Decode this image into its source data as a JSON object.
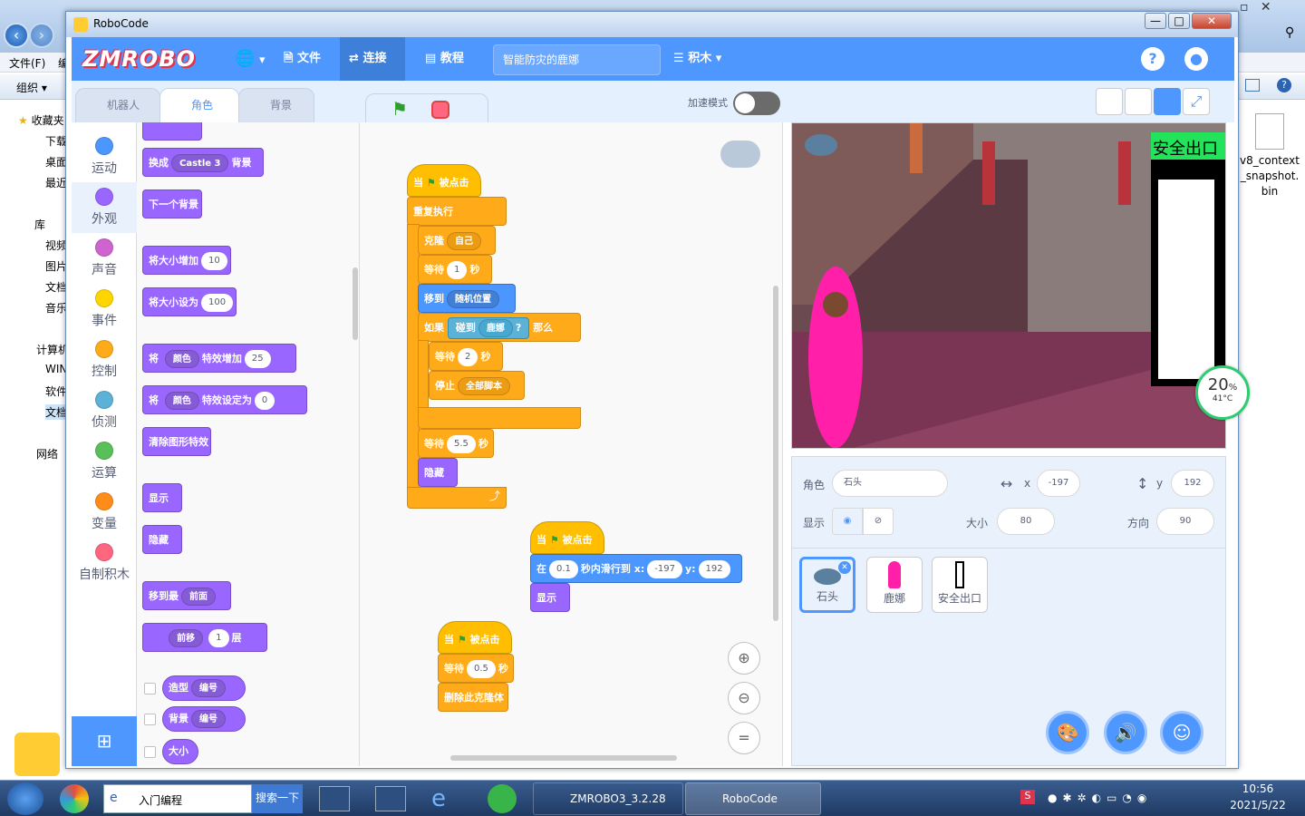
{
  "explorer": {
    "menu": [
      "文件(F)",
      "编"
    ],
    "toolbar_label": "组织 ▾",
    "side_items": [
      "收藏夹",
      "下载",
      "桌面",
      "最近",
      "库",
      "视频",
      "图片",
      "文档",
      "音乐",
      "计算机",
      "WIN",
      "软件",
      "文档",
      "网络"
    ],
    "file_name": "v8_context_snapshot.bin",
    "file_lines": [
      "v8_context",
      "_snapshot.",
      "bin"
    ]
  },
  "window": {
    "title": "RoboCode",
    "controls": [
      "—",
      "□",
      "✕"
    ]
  },
  "menubar": {
    "logo": "ZMROBO",
    "file": "文件",
    "connect": "连接",
    "tutorial": "教程",
    "project_name": "智能防灾的鹿娜",
    "blocks": "积木"
  },
  "tabs": {
    "robot": "机器人",
    "sprite": "角色",
    "backdrop": "背景",
    "turbo": "加速模式"
  },
  "categories": [
    {
      "label": "运动",
      "color": "#4c97ff"
    },
    {
      "label": "外观",
      "color": "#9966ff"
    },
    {
      "label": "声音",
      "color": "#cf63cf"
    },
    {
      "label": "事件",
      "color": "#ffd500"
    },
    {
      "label": "控制",
      "color": "#ffab19"
    },
    {
      "label": "侦测",
      "color": "#5cb1d6"
    },
    {
      "label": "运算",
      "color": "#59c059"
    },
    {
      "label": "变量",
      "color": "#ff8c1a"
    },
    {
      "label": "自制积木",
      "color": "#ff6680"
    }
  ],
  "palette": {
    "switch_backdrop": "换成",
    "backdrop_value": "Castle 3",
    "backdrop_word": "背景",
    "next_backdrop": "下一个背景",
    "change_size": "将大小增加",
    "change_size_val": "10",
    "set_size": "将大小设为",
    "set_size_val": "100",
    "effect_change_pre": "将",
    "effect_name": "颜色",
    "effect_change": "特效增加",
    "effect_change_val": "25",
    "effect_set": "特效设定为",
    "effect_set_val": "0",
    "clear_effects": "清除图形特效",
    "show": "显示",
    "hide": "隐藏",
    "goto_layer": "移到最",
    "layer_value": "前面",
    "go_layers": "前移",
    "layers_val": "1",
    "layers_unit": "层",
    "costume": "造型",
    "costume_sel": "编号",
    "backdrop_rep": "背景",
    "backdrop_sel": "编号",
    "size_rep": "大小"
  },
  "script1": {
    "when_pre": "当",
    "when_post": "被点击",
    "forever": "重复执行",
    "clone": "克隆",
    "clone_target": "自己",
    "wait": "等待",
    "wait1": "1",
    "sec": "秒",
    "goto": "移到",
    "goto_target": "随机位置",
    "if": "如果",
    "touching": "碰到",
    "touch_target": "鹿娜",
    "q": "?",
    "then": "那么",
    "wait2": "2",
    "stop": "停止",
    "stop_target": "全部脚本",
    "wait3": "5.5",
    "hide": "隐藏"
  },
  "script2": {
    "glide_pre": "在",
    "glide_secs": "0.1",
    "glide_mid": "秒内滑行到 x:",
    "glide_x": "-197",
    "glide_y_label": "y:",
    "glide_y": "192",
    "show": "显示"
  },
  "script3": {
    "wait_val": "0.5",
    "delete_clone": "删除此克隆体"
  },
  "stage": {
    "exit_label": "安全出口",
    "gauge_pct": "20",
    "gauge_unit": "%",
    "gauge_temp": "41°C"
  },
  "sprite_info": {
    "sprite_label": "角色",
    "sprite_name": "石头",
    "x_label": "x",
    "x": "-197",
    "y_label": "y",
    "y": "192",
    "show_label": "显示",
    "size_label": "大小",
    "size": "80",
    "dir_label": "方向",
    "direction": "90"
  },
  "sprites": [
    "石头",
    "鹿娜",
    "安全出口"
  ],
  "taskbar": {
    "search_text": "入门编程",
    "search_btn": "搜索一下",
    "zmrobo": "ZMROBO3_3.2.28",
    "robocode": "RoboCode",
    "time": "10:56",
    "date": "2021/5/22"
  },
  "colors": {
    "accent": "#4d97ff",
    "looks": "#9966ff",
    "control": "#ffab19",
    "events": "#ffbf00"
  }
}
